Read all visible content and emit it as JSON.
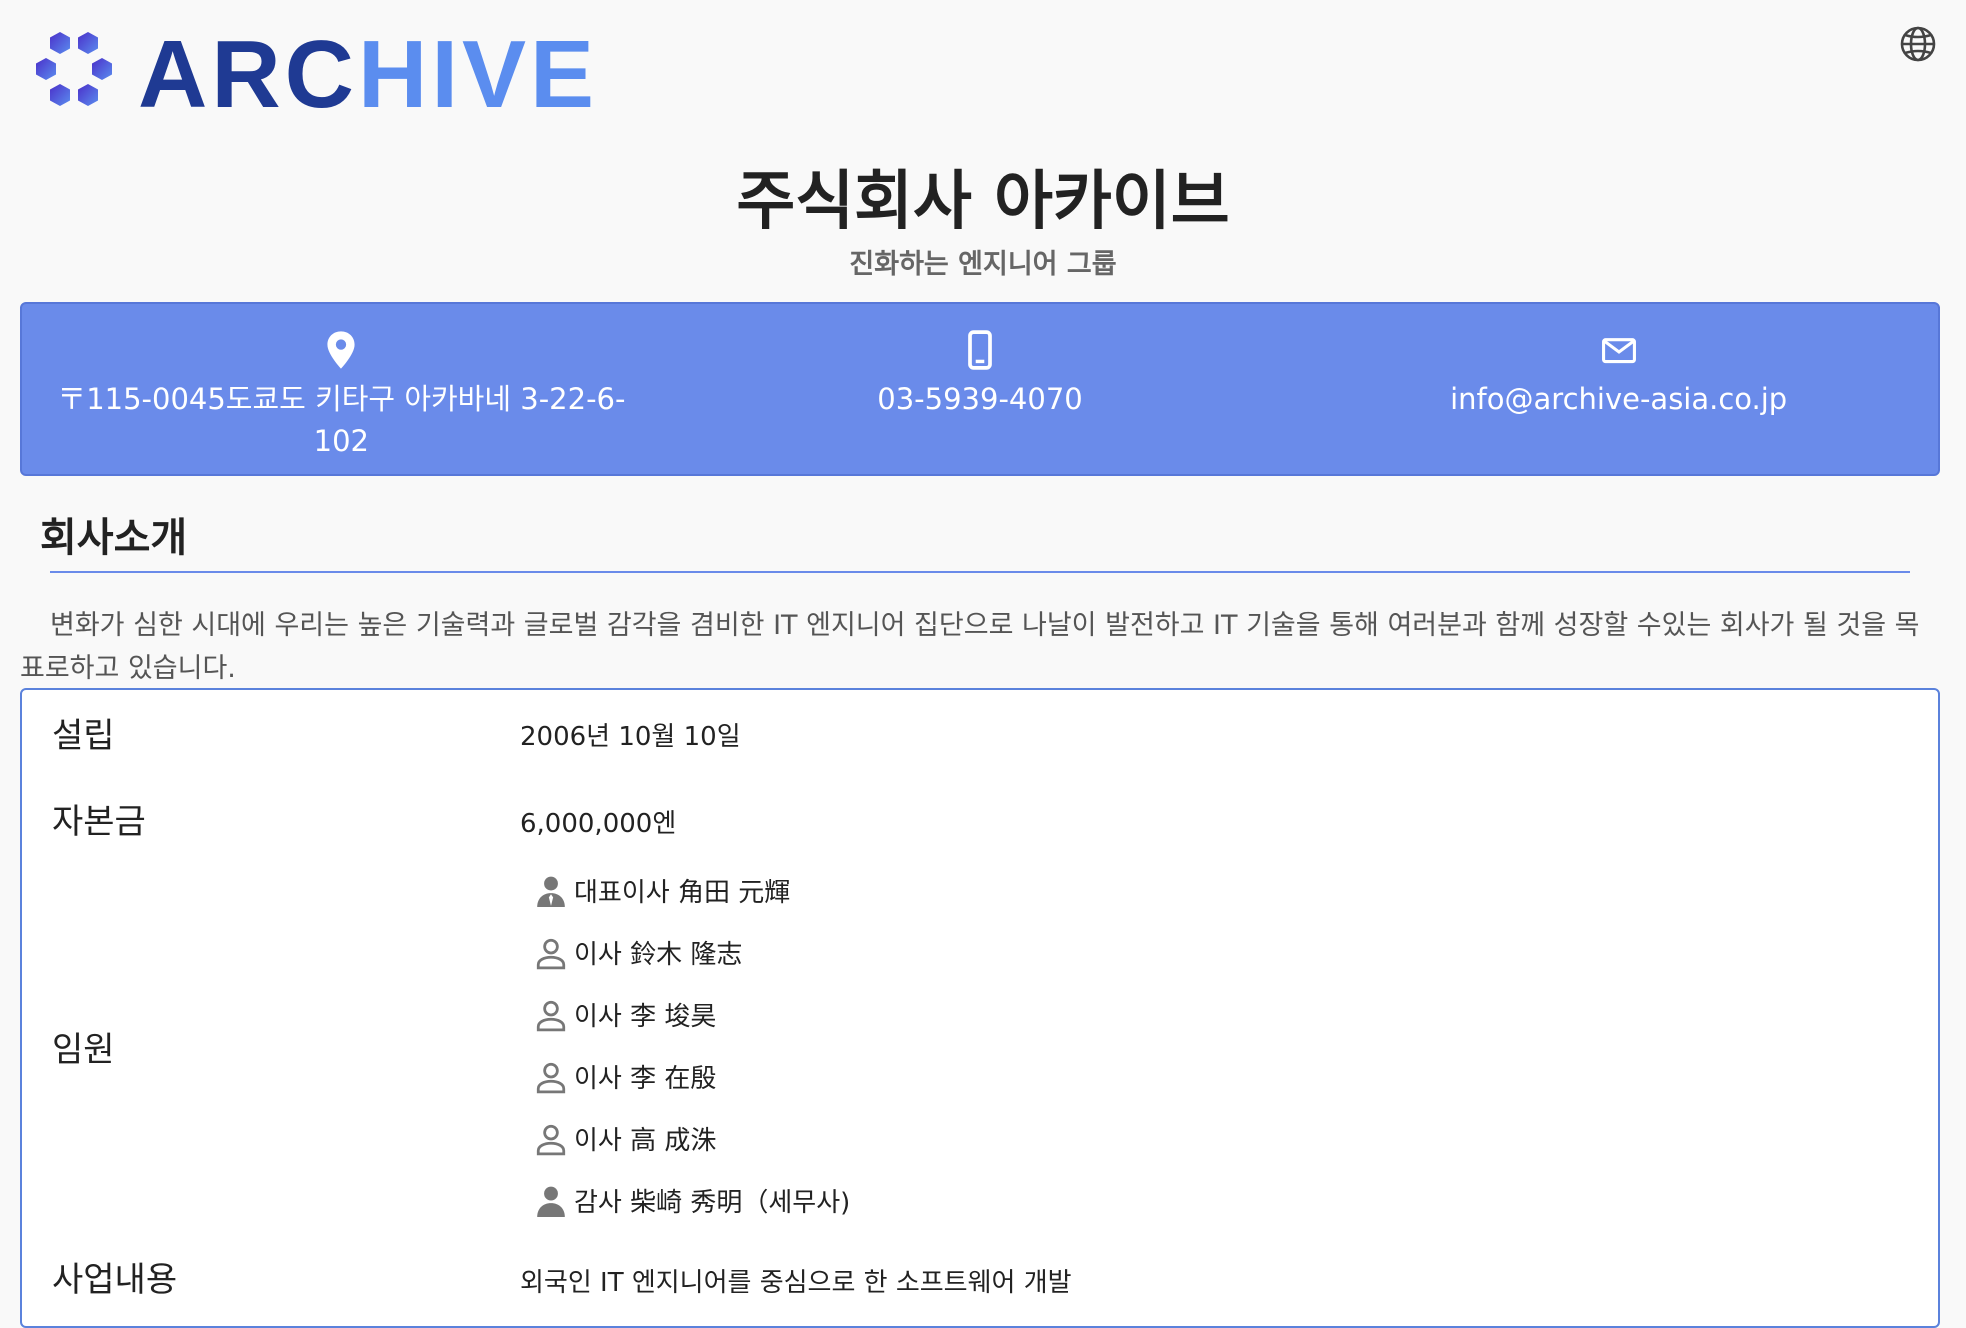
{
  "logo": {
    "part1": "ARC",
    "part2": "HIVE",
    "colors": {
      "dark": "#1f3a93",
      "light": "#5b8def"
    }
  },
  "header": {
    "globe_icon": "globe-icon"
  },
  "company": {
    "name": "주식회사 아카이브",
    "tagline": "진화하는 엔지니어 그룹"
  },
  "contact": {
    "address": "〒115-0045도쿄도 키타구 아카바네 3-22-6-102",
    "phone": "03-5939-4070",
    "email": "info@archive-asia.co.jp",
    "bar_color": "#6a8bea"
  },
  "about": {
    "heading": "회사소개",
    "text": "변화가 심한 시대에 우리는 높은 기술력과 글로벌 감각을 겸비한 IT 엔지니어 집단으로 나날이 발전하고 IT 기술을 통해 여러분과 함께 성장할 수있는 회사가 될 것을 목표로하고 있습니다."
  },
  "info": {
    "established_label": "설립",
    "established_value": "2006년 10월 10일",
    "capital_label": "자본금",
    "capital_value": "6,000,000엔",
    "officers_label": "임원",
    "officers": [
      {
        "name": "대표이사 角田 元輝",
        "icon": "businessman-icon"
      },
      {
        "name": "이사 鈴木 隆志",
        "icon": "person-outline-icon"
      },
      {
        "name": "이사 李 埈昊",
        "icon": "person-outline-icon"
      },
      {
        "name": "이사 李 在殷",
        "icon": "person-outline-icon"
      },
      {
        "name": "이사 高 成洙",
        "icon": "person-outline-icon"
      },
      {
        "name": "감사 柴崎 秀明（세무사)",
        "icon": "person-filled-icon"
      }
    ],
    "business_label": "사업내용",
    "business_value": "외국인 IT 엔지니어를 중심으로 한 소프트웨어 개발"
  }
}
